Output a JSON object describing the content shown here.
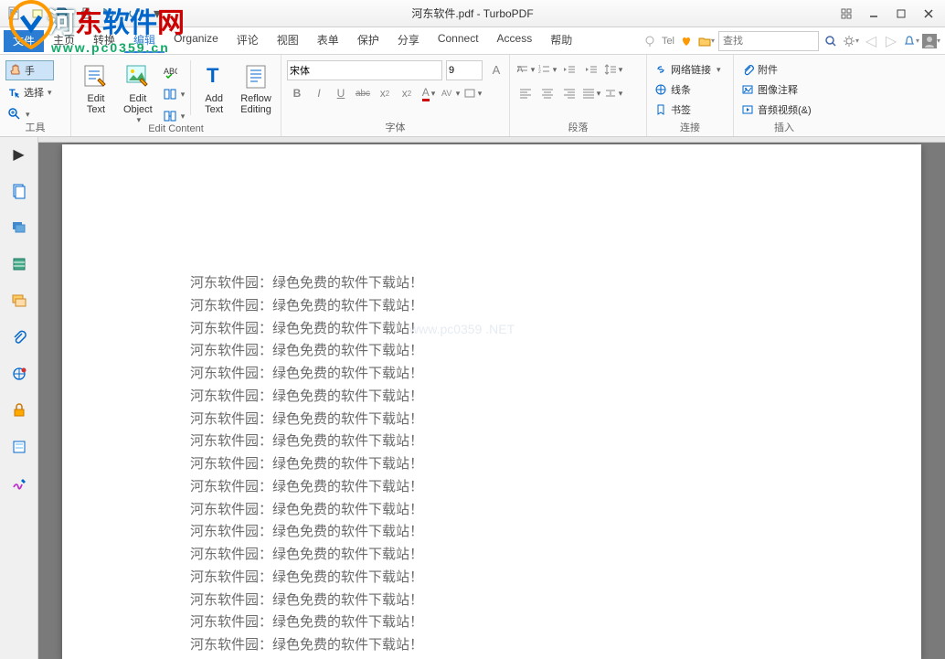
{
  "window": {
    "title": "河东软件.pdf - TurboPDF"
  },
  "menubar": {
    "file": "文件",
    "items": [
      "主页",
      "转换",
      "编辑",
      "Organize",
      "评论",
      "视图",
      "表单",
      "保护",
      "分享",
      "Connect",
      "Access",
      "帮助"
    ],
    "active_index": 2,
    "tel": "Tel",
    "search_placeholder": "查找"
  },
  "ribbon": {
    "tools_group": {
      "label": "工具",
      "hand": "手",
      "select": "选择"
    },
    "edit_content": {
      "label": "Edit Content",
      "edit_text": "Edit Text",
      "edit_object": "Edit Object",
      "add_text": "Add Text",
      "reflow": "Reflow Editing"
    },
    "font": {
      "label": "字体",
      "family": "宋体",
      "size": "9",
      "bold": "B",
      "italic": "I",
      "underline": "U",
      "strike": "abc",
      "super": "x²",
      "sub": "x₂"
    },
    "paragraph": {
      "label": "段落"
    },
    "links": {
      "label": "连接",
      "webLink": "网络链接",
      "line": "线条",
      "bookmark": "书签"
    },
    "insert": {
      "label": "插入",
      "attachment": "附件",
      "imageAnnotation": "图像注释",
      "audioVideo": "音频视频(&)"
    }
  },
  "document": {
    "line": "河东软件园：绿色免费的软件下载站！",
    "repeat": 17
  },
  "watermark": {
    "main": "河东软件网",
    "sub": "www.pc0359.cn"
  }
}
